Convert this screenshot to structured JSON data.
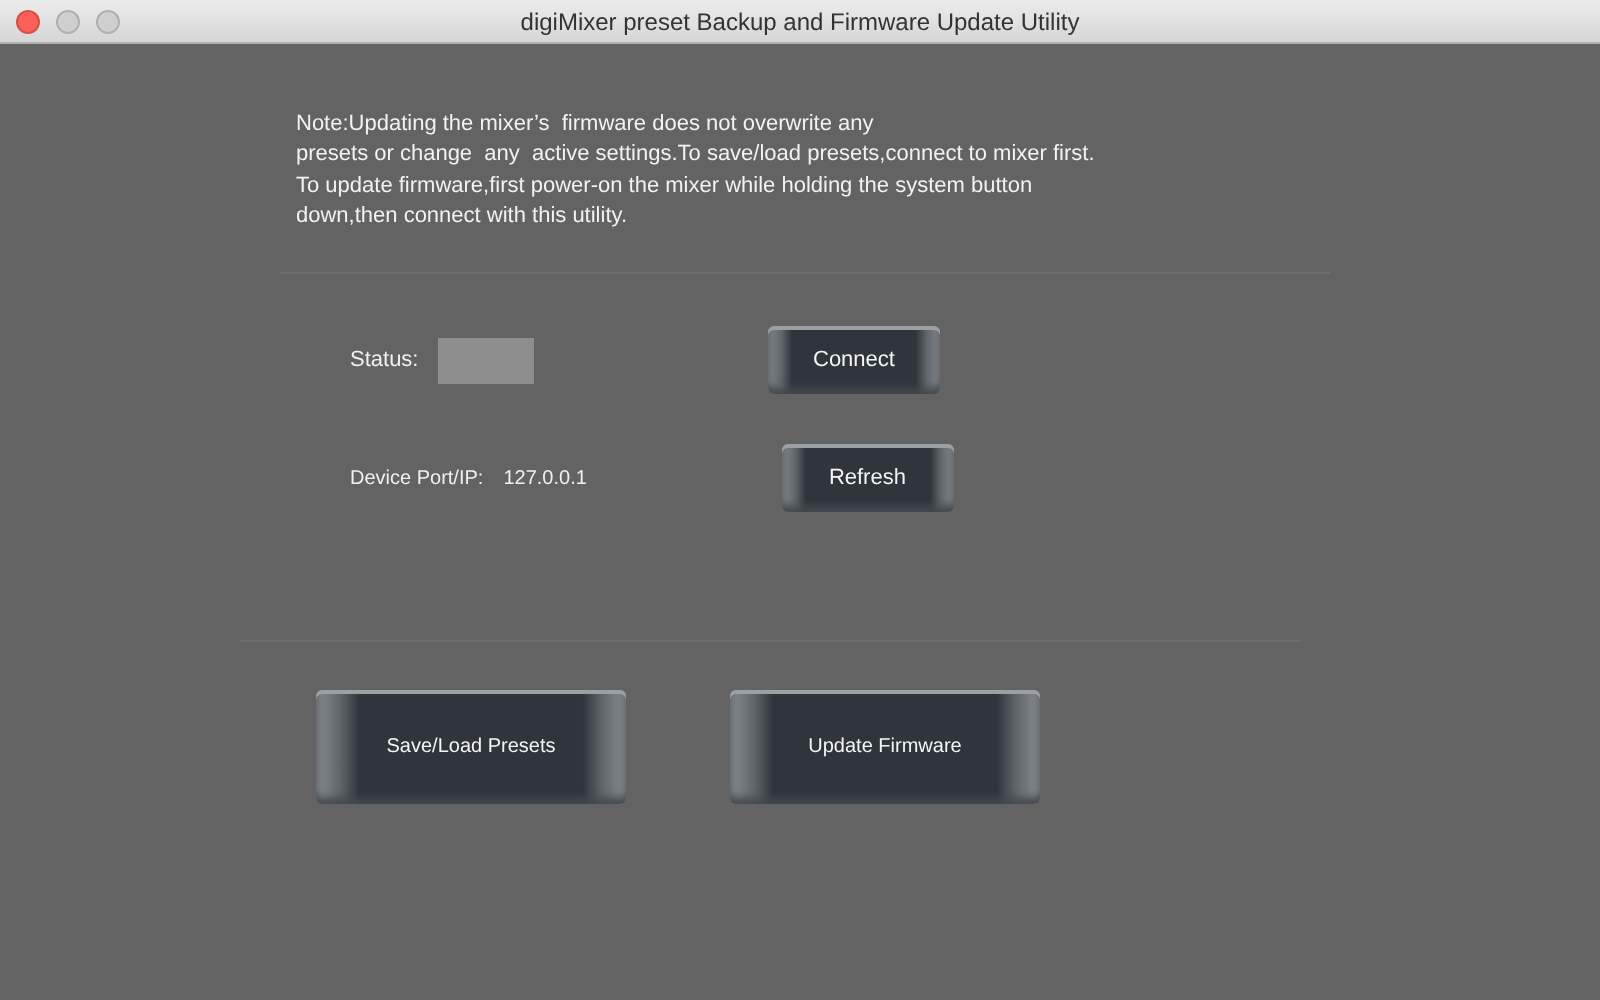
{
  "window": {
    "title": "digiMixer preset Backup and Firmware Update Utility"
  },
  "note": [
    "Note:Updating the mixer’s  firmware does not overwrite any",
    "presets or change  any  active settings.To save/load presets,connect to mixer first.",
    "To update firmware,first power-on the mixer while holding the system button",
    "down,then connect with this utility."
  ],
  "status": {
    "label": "Status:"
  },
  "device": {
    "label": "Device Port/IP:",
    "value": "127.0.0.1"
  },
  "buttons": {
    "connect": "Connect",
    "refresh": "Refresh",
    "save_load": "Save/Load Presets",
    "update": "Update Firmware"
  }
}
